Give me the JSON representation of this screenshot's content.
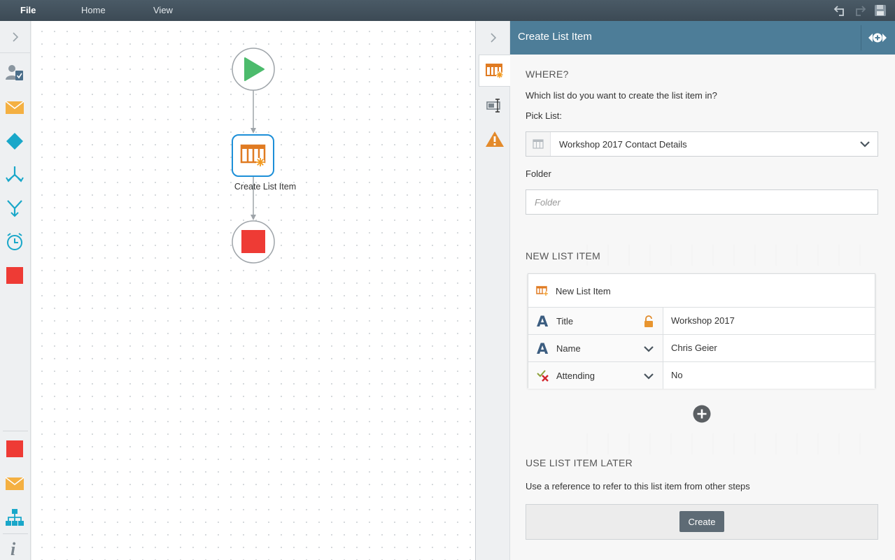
{
  "menubar": {
    "file": "File",
    "home": "Home",
    "view": "View"
  },
  "canvas": {
    "node_label": "Create List Item"
  },
  "panel": {
    "title": "Create List Item",
    "where": {
      "heading": "WHERE?",
      "question": "Which list do you want to create the list item in?",
      "pick_list_label": "Pick List:",
      "pick_list_value": "Workshop 2017 Contact Details",
      "folder_label": "Folder",
      "folder_placeholder": "Folder"
    },
    "new_list_item": {
      "heading": "NEW LIST ITEM",
      "card_title": "New List Item",
      "fields": [
        {
          "name": "Title",
          "value": "Workshop 2017"
        },
        {
          "name": "Name",
          "value": "Chris Geier"
        },
        {
          "name": "Attending",
          "value": "No"
        }
      ]
    },
    "later": {
      "heading": "USE LIST ITEM LATER",
      "description": "Use a reference to refer to this list item from other steps",
      "create_label": "Create"
    }
  },
  "colors": {
    "menubar": "#3f4d58",
    "panel_header": "#4d7d98",
    "start_green": "#4cbb6c",
    "stop_red": "#ee3b35",
    "node_orange": "#e07b22",
    "node_border_blue": "#1d8fd8",
    "toolbox_teal": "#19a7c9",
    "warning_orange": "#e38a2b",
    "create_button": "#5e6b75"
  }
}
